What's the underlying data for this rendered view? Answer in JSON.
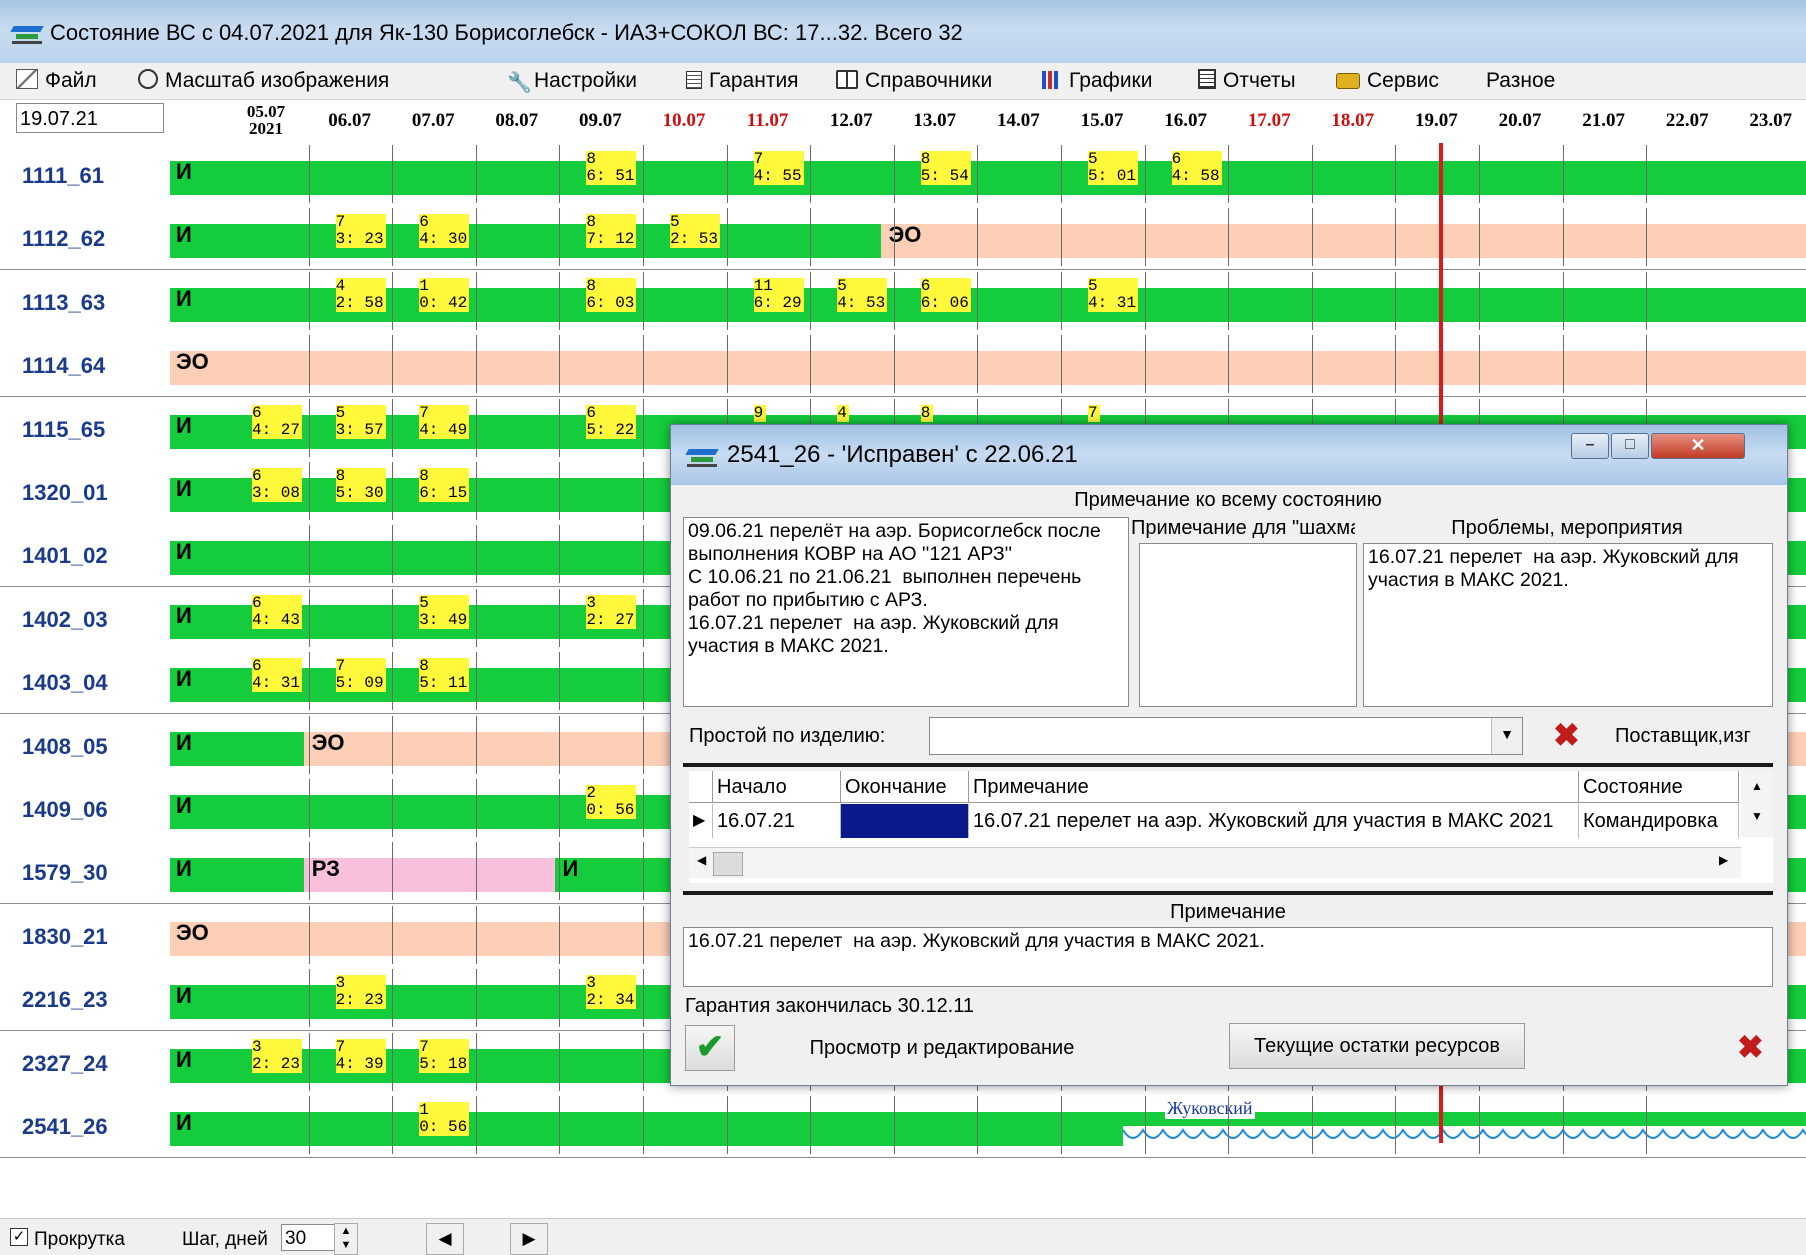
{
  "window": {
    "title": "Состояние ВС  с 04.07.2021  для  Як-130   Борисоглебск - ИАЗ+СОКОЛ      ВС: 17...32.  Всего 32"
  },
  "menu": [
    {
      "label": "Файл",
      "icon": "file-icon"
    },
    {
      "label": "Масштаб изображения",
      "icon": "zoom-icon"
    },
    {
      "label": "Настройки",
      "icon": "wrench-icon"
    },
    {
      "label": "Гарантия",
      "icon": "calendar-icon"
    },
    {
      "label": "Справочники",
      "icon": "book-icon"
    },
    {
      "label": "Графики",
      "icon": "chart-icon"
    },
    {
      "label": "Отчеты",
      "icon": "report-icon"
    },
    {
      "label": "Сервис",
      "icon": "service-icon"
    },
    {
      "label": "Разное",
      "icon": ""
    }
  ],
  "current_date": "19.07.21",
  "dates": [
    {
      "label": "05.07",
      "year": "2021",
      "red": false
    },
    {
      "label": "06.07",
      "red": false
    },
    {
      "label": "07.07",
      "red": false
    },
    {
      "label": "08.07",
      "red": false
    },
    {
      "label": "09.07",
      "red": false
    },
    {
      "label": "10.07",
      "red": true
    },
    {
      "label": "11.07",
      "red": true
    },
    {
      "label": "12.07",
      "red": false
    },
    {
      "label": "13.07",
      "red": false
    },
    {
      "label": "14.07",
      "red": false
    },
    {
      "label": "15.07",
      "red": false
    },
    {
      "label": "16.07",
      "red": false
    },
    {
      "label": "17.07",
      "red": true
    },
    {
      "label": "18.07",
      "red": true
    },
    {
      "label": "19.07",
      "red": false
    },
    {
      "label": "20.07",
      "red": false
    },
    {
      "label": "21.07",
      "red": false
    },
    {
      "label": "22.07",
      "red": false
    },
    {
      "label": "23.07",
      "red": false
    }
  ],
  "rows": [
    {
      "id": "1111_61",
      "code": "И",
      "segments": [
        {
          "from": 0,
          "to": 19,
          "color": "green"
        }
      ],
      "markers": [
        {
          "day": 5,
          "a": "8",
          "b": "6: 51"
        },
        {
          "day": 7,
          "a": "7",
          "b": "4: 55"
        },
        {
          "day": 9,
          "a": "8",
          "b": "5: 54"
        },
        {
          "day": 11,
          "a": "5",
          "b": "5: 01"
        },
        {
          "day": 12,
          "a": "6",
          "b": "4: 58"
        }
      ]
    },
    {
      "id": "1112_62",
      "code": "И",
      "segments": [
        {
          "from": 0,
          "to": 8.5,
          "color": "green"
        },
        {
          "from": 8.5,
          "to": 19,
          "color": "salmon",
          "text": "ЭО"
        }
      ],
      "markers": [
        {
          "day": 2,
          "a": "7",
          "b": "3: 23"
        },
        {
          "day": 3,
          "a": "6",
          "b": "4: 30"
        },
        {
          "day": 5,
          "a": "8",
          "b": "7: 12"
        },
        {
          "day": 6,
          "a": "5",
          "b": "2: 53"
        }
      ]
    },
    {
      "id": "1113_63",
      "code": "И",
      "segments": [
        {
          "from": 0,
          "to": 19,
          "color": "green"
        }
      ],
      "markers": [
        {
          "day": 2,
          "a": "4",
          "b": "2: 58"
        },
        {
          "day": 3,
          "a": "1",
          "b": "0: 42"
        },
        {
          "day": 5,
          "a": "8",
          "b": "6: 03"
        },
        {
          "day": 7,
          "a": "11",
          "b": "6: 29"
        },
        {
          "day": 8,
          "a": "5",
          "b": "4: 53"
        },
        {
          "day": 9,
          "a": "6",
          "b": "6: 06"
        },
        {
          "day": 11,
          "a": "5",
          "b": "4: 31"
        }
      ]
    },
    {
      "id": "1114_64",
      "code": "ЭО",
      "segments": [
        {
          "from": 0,
          "to": 19,
          "color": "salmon"
        }
      ],
      "markers": []
    },
    {
      "id": "1115_65",
      "code": "И",
      "segments": [
        {
          "from": 0,
          "to": 19,
          "color": "green"
        }
      ],
      "markers": [
        {
          "day": 1,
          "a": "6",
          "b": "4: 27"
        },
        {
          "day": 2,
          "a": "5",
          "b": "3: 57"
        },
        {
          "day": 3,
          "a": "7",
          "b": "4: 49"
        },
        {
          "day": 5,
          "a": "6",
          "b": "5: 22"
        },
        {
          "day": 7,
          "a": "9",
          "b": ""
        },
        {
          "day": 8,
          "a": "4",
          "b": ""
        },
        {
          "day": 9,
          "a": "8",
          "b": ""
        },
        {
          "day": 11,
          "a": "7",
          "b": ""
        }
      ]
    },
    {
      "id": "1320_01",
      "code": "И",
      "segments": [
        {
          "from": 0,
          "to": 19,
          "color": "green"
        }
      ],
      "markers": [
        {
          "day": 1,
          "a": "6",
          "b": "3: 08"
        },
        {
          "day": 2,
          "a": "8",
          "b": "5: 30"
        },
        {
          "day": 3,
          "a": "8",
          "b": "6: 15"
        }
      ]
    },
    {
      "id": "1401_02",
      "code": "И",
      "segments": [
        {
          "from": 0,
          "to": 19,
          "color": "green"
        }
      ],
      "markers": []
    },
    {
      "id": "1402_03",
      "code": "И",
      "segments": [
        {
          "from": 0,
          "to": 19,
          "color": "green"
        }
      ],
      "markers": [
        {
          "day": 1,
          "a": "6",
          "b": "4: 43"
        },
        {
          "day": 3,
          "a": "5",
          "b": "3: 49"
        },
        {
          "day": 5,
          "a": "3",
          "b": "2: 27"
        }
      ]
    },
    {
      "id": "1403_04",
      "code": "И",
      "segments": [
        {
          "from": 0,
          "to": 19,
          "color": "green"
        }
      ],
      "markers": [
        {
          "day": 1,
          "a": "6",
          "b": "4: 31"
        },
        {
          "day": 2,
          "a": "7",
          "b": "5: 09"
        },
        {
          "day": 3,
          "a": "8",
          "b": "5: 11"
        }
      ]
    },
    {
      "id": "1408_05",
      "code": "И",
      "segments": [
        {
          "from": 0,
          "to": 1.6,
          "color": "green"
        },
        {
          "from": 1.6,
          "to": 19,
          "color": "salmon",
          "text": "ЭО"
        }
      ],
      "markers": []
    },
    {
      "id": "1409_06",
      "code": "И",
      "segments": [
        {
          "from": 0,
          "to": 19,
          "color": "green"
        }
      ],
      "markers": [
        {
          "day": 5,
          "a": "2",
          "b": "0: 56"
        }
      ]
    },
    {
      "id": "1579_30",
      "code": "И",
      "segments": [
        {
          "from": 0,
          "to": 1.6,
          "color": "green"
        },
        {
          "from": 1.6,
          "to": 4.6,
          "color": "pink",
          "text": "РЗ"
        },
        {
          "from": 4.6,
          "to": 19,
          "color": "green",
          "text": "И"
        }
      ],
      "markers": []
    },
    {
      "id": "1830_21",
      "code": "ЭО",
      "segments": [
        {
          "from": 0,
          "to": 19,
          "color": "salmon"
        }
      ],
      "markers": []
    },
    {
      "id": "2216_23",
      "code": "И",
      "segments": [
        {
          "from": 0,
          "to": 19,
          "color": "green"
        }
      ],
      "markers": [
        {
          "day": 2,
          "a": "3",
          "b": "2: 23"
        },
        {
          "day": 5,
          "a": "3",
          "b": "2: 34"
        }
      ]
    },
    {
      "id": "2327_24",
      "code": "И",
      "segments": [
        {
          "from": 0,
          "to": 19,
          "color": "green"
        }
      ],
      "markers": [
        {
          "day": 1,
          "a": "3",
          "b": "2: 23"
        },
        {
          "day": 2,
          "a": "7",
          "b": "4: 39"
        },
        {
          "day": 3,
          "a": "7",
          "b": "5: 18"
        }
      ]
    },
    {
      "id": "2541_26",
      "code": "И",
      "segments": [
        {
          "from": 0,
          "to": 11.4,
          "color": "green"
        },
        {
          "from": 11.4,
          "to": 19,
          "color": "green",
          "wavy": true,
          "text": "Жуковский"
        }
      ],
      "markers": [
        {
          "day": 3,
          "a": "1",
          "b": "0: 56"
        }
      ]
    }
  ],
  "status": {
    "scroll_label": "Прокрутка",
    "scroll_checked": true,
    "step_label": "Шаг, дней",
    "step_value": "30",
    "prev": "◀",
    "next": "▶"
  },
  "dialog": {
    "title": "2541_26 - 'Исправен' с 22.06.21",
    "note_all_header": "Примечание ко всему состоянию",
    "note_all_text": "09.06.21 перелёт на аэр. Борисоглебск после выполнения КОВР на АО ''121 АРЗ''\nС 10.06.21 по 21.06.21  выполнен перечень работ по прибытию с АРЗ.\n16.07.21 перелет  на аэр. Жуковский для участия в МАКС 2021.",
    "chess_header": "Примечание для \"шахмат\"",
    "chess_text": "",
    "problems_header": "Проблемы, мероприятия",
    "problems_text": "16.07.21 перелет  на аэр. Жуковский для участия в МАКС 2021.",
    "idle_label": "Простой по изделию:",
    "idle_value": "",
    "supplier_label": "Поставщик,изг",
    "grid": {
      "columns": [
        "Начало",
        "Окончание",
        "Примечание",
        "Состояние"
      ],
      "rows": [
        {
          "start": "16.07.21",
          "end": "",
          "note": "16.07.21 перелет  на аэр. Жуковский для участия в МАКС 2021",
          "state": "Командировка"
        }
      ]
    },
    "note_header": "Примечание",
    "note_text": "16.07.21 перелет  на аэр. Жуковский для участия в МАКС 2021.",
    "warranty_text": "Гарантия закончилась 30.12.11",
    "view_edit_button": "Просмотр и редактирование",
    "resources_button": "Текущие остатки ресурсов"
  },
  "colors": {
    "green": "#14cc3c",
    "salmon": "#fccfb6",
    "pink": "#f8c0dc",
    "marker": "#fff83b",
    "today_line": "#d61c1c",
    "row_label": "#1a3a8c"
  }
}
